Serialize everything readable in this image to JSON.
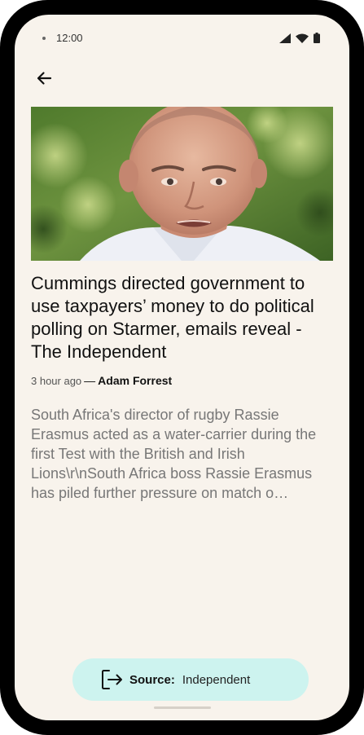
{
  "status_bar": {
    "time": "12:00",
    "icons": [
      "signal-icon",
      "wifi-icon",
      "battery-icon"
    ]
  },
  "app_bar": {
    "back_icon": "arrow-back-icon"
  },
  "article": {
    "image_description": "photo",
    "headline": "Cummings directed government to use taxpayers’ money to do political polling on Starmer, emails reveal - The Independent",
    "time_ago": "3 hour ago",
    "separator": "—",
    "author": "Adam Forrest",
    "summary": "South Africa's director of rugby Rassie Erasmus acted as a water-carrier during the first Test with the British and Irish Lions\\r\\nSouth Africa boss Rassie Erasmus has piled further pressure on match o…"
  },
  "source_chip": {
    "icon": "open-external-icon",
    "label": "Source:",
    "name": "Independent"
  },
  "colors": {
    "screen_background": "#f8f3ec",
    "chip_background": "#cdf3ef",
    "summary_text": "#777777"
  }
}
